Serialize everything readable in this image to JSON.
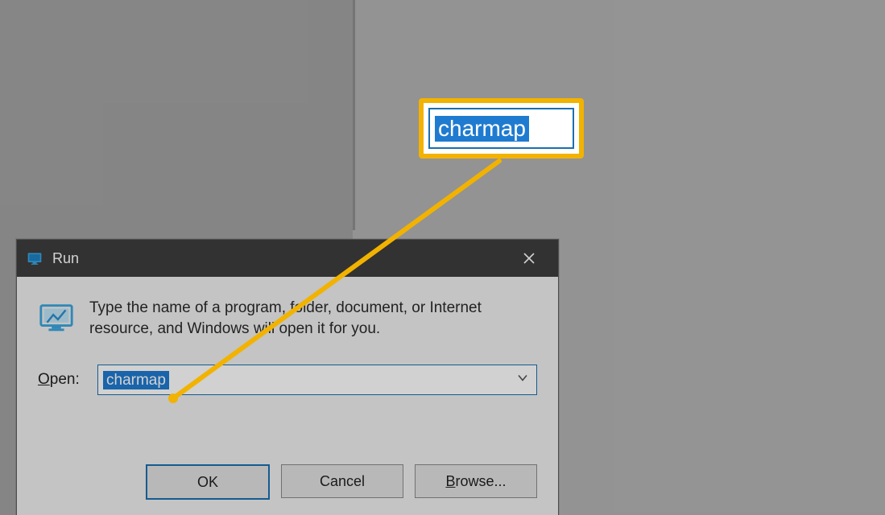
{
  "dialog": {
    "title": "Run",
    "prompt": "Type the name of a program, folder, document, or Internet resource, and Windows will open it for you.",
    "open_label_prefix": "O",
    "open_label_rest": "pen:",
    "input_value": "charmap",
    "buttons": {
      "ok": "OK",
      "cancel": "Cancel",
      "browse_prefix": "B",
      "browse_rest": "rowse..."
    }
  },
  "callout": {
    "text": "charmap"
  },
  "colors": {
    "highlight": "#f2b200",
    "selection": "#1f7bd0",
    "dialog_border": "#1a6fb0"
  }
}
